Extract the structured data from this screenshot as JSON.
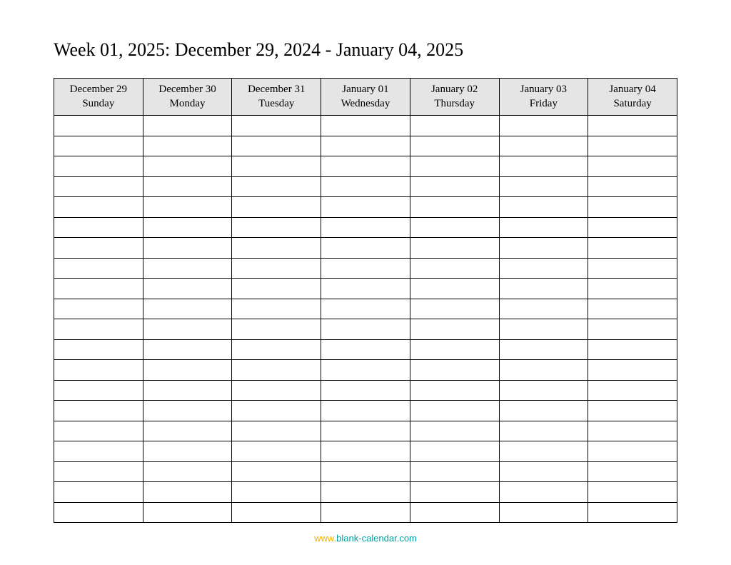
{
  "title": "Week 01, 2025: December 29, 2024 - January 04, 2025",
  "days": [
    {
      "date": "December 29",
      "weekday": "Sunday"
    },
    {
      "date": "December 30",
      "weekday": "Monday"
    },
    {
      "date": "December 31",
      "weekday": "Tuesday"
    },
    {
      "date": "January 01",
      "weekday": "Wednesday"
    },
    {
      "date": "January 02",
      "weekday": "Thursday"
    },
    {
      "date": "January 03",
      "weekday": "Friday"
    },
    {
      "date": "January 04",
      "weekday": "Saturday"
    }
  ],
  "row_count": 20,
  "footer": {
    "www": "www.",
    "domain": "blank-calendar.com"
  }
}
